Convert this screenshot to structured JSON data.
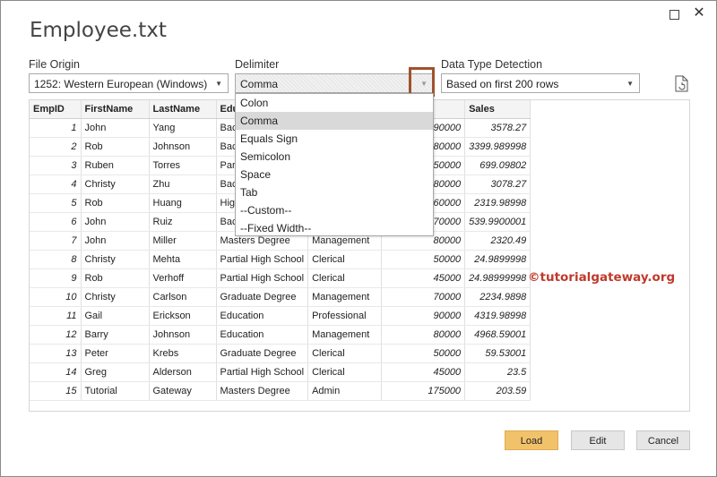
{
  "window": {
    "title": "Employee.txt",
    "maximize_icon": "square-icon",
    "close_label": "✕"
  },
  "file_origin": {
    "label": "File Origin",
    "value": "1252: Western European (Windows)"
  },
  "delimiter": {
    "label": "Delimiter",
    "value": "Comma",
    "options": [
      "Colon",
      "Comma",
      "Equals Sign",
      "Semicolon",
      "Space",
      "Tab",
      "--Custom--",
      "--Fixed Width--"
    ],
    "selected_index": 1
  },
  "data_type_detection": {
    "label": "Data Type Detection",
    "value": "Based on first 200 rows"
  },
  "table": {
    "headers": [
      "EmpID",
      "FirstName",
      "LastName",
      "Edu",
      "",
      "me",
      "Sales"
    ],
    "rows": [
      [
        "1",
        "John",
        "Yang",
        "Bac",
        "",
        "90000",
        "3578.27"
      ],
      [
        "2",
        "Rob",
        "Johnson",
        "Bac",
        "",
        "80000",
        "3399.989998"
      ],
      [
        "3",
        "Ruben",
        "Torres",
        "Par",
        "",
        "50000",
        "699.09802"
      ],
      [
        "4",
        "Christy",
        "Zhu",
        "Bac",
        "",
        "80000",
        "3078.27"
      ],
      [
        "5",
        "Rob",
        "Huang",
        "Hig",
        "",
        "60000",
        "2319.98998"
      ],
      [
        "6",
        "John",
        "Ruiz",
        "Bac",
        "",
        "70000",
        "539.9900001"
      ],
      [
        "7",
        "John",
        "Miller",
        "Masters Degree",
        "Management",
        "80000",
        "2320.49"
      ],
      [
        "8",
        "Christy",
        "Mehta",
        "Partial High School",
        "Clerical",
        "50000",
        "24.9899998"
      ],
      [
        "9",
        "Rob",
        "Verhoff",
        "Partial High School",
        "Clerical",
        "45000",
        "24.98999998"
      ],
      [
        "10",
        "Christy",
        "Carlson",
        "Graduate Degree",
        "Management",
        "70000",
        "2234.9898"
      ],
      [
        "11",
        "Gail",
        "Erickson",
        "Education",
        "Professional",
        "90000",
        "4319.98998"
      ],
      [
        "12",
        "Barry",
        "Johnson",
        "Education",
        "Management",
        "80000",
        "4968.59001"
      ],
      [
        "13",
        "Peter",
        "Krebs",
        "Graduate Degree",
        "Clerical",
        "50000",
        "59.53001"
      ],
      [
        "14",
        "Greg",
        "Alderson",
        "Partial High School",
        "Clerical",
        "45000",
        "23.5"
      ],
      [
        "15",
        "Tutorial",
        "Gateway",
        "Masters Degree",
        "Admin",
        "175000",
        "203.59"
      ]
    ]
  },
  "watermark": "©tutorialgateway.org",
  "buttons": {
    "load": "Load",
    "edit": "Edit",
    "cancel": "Cancel"
  },
  "colors": {
    "load_button": "#f2c26b",
    "highlight_box": "#a0522d",
    "watermark": "#c0392b"
  }
}
